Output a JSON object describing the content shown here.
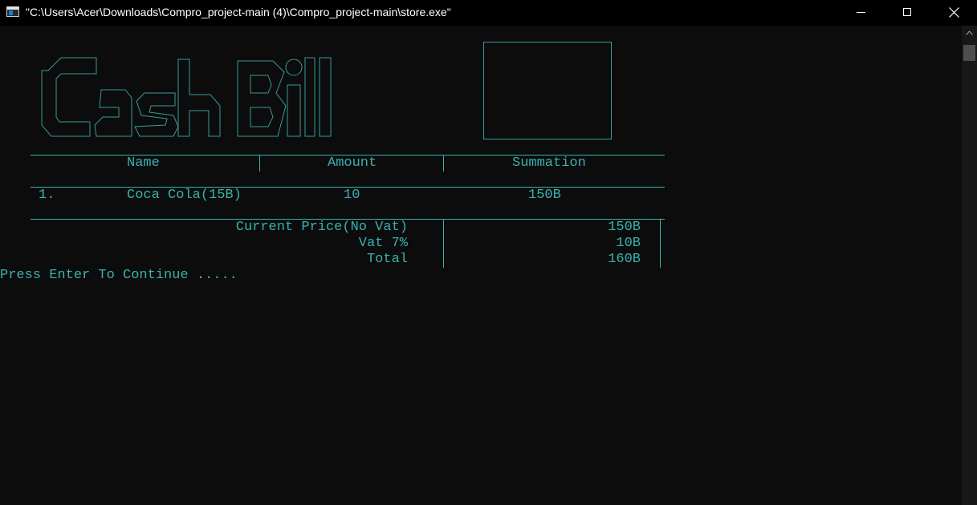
{
  "window": {
    "title": "\"C:\\Users\\Acer\\Downloads\\Compro_project-main (4)\\Compro_project-main\\store.exe\""
  },
  "logo": {
    "text": "Cash Bill"
  },
  "table": {
    "headers": {
      "name": "Name",
      "amount": "Amount",
      "summation": "Summation"
    },
    "rows": [
      {
        "index": "1.",
        "name": "Coca Cola(15B)",
        "amount": "10",
        "summation": "150B"
      }
    ]
  },
  "totals": {
    "current_price_label": "Current Price(No Vat)",
    "current_price_value": "150B",
    "vat_label": "Vat 7%",
    "vat_value": "10B",
    "total_label": "Total",
    "total_value": "160B"
  },
  "prompt": "Press Enter To Continue .....",
  "colors": {
    "background": "#0c0c0c",
    "text": "#3ab0b0",
    "titlebar": "#000000"
  }
}
